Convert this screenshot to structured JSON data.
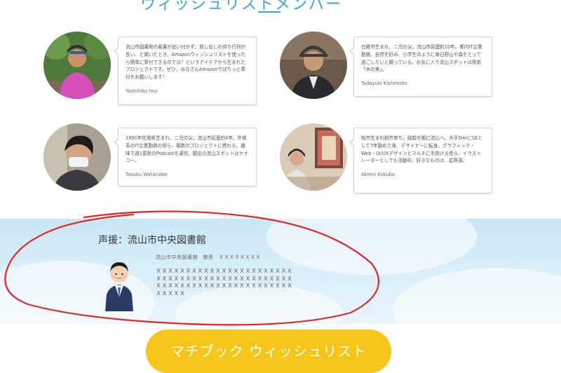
{
  "section": {
    "title": "ウィッシュリストメンバー"
  },
  "members": [
    {
      "desc": "流山市図書館の蔵書が追い付かず、貸し出しの待ち行列が長い、と聞いたとき、Amazonウィッシュリストを使ったら簡単に寄付できるのでは？というアイデアから生まれたプロジェクトです。ぜひ、みなさんAmazonでぽちっと寄付をお願いします！",
      "name": "Yoshihiko Inui"
    },
    {
      "desc": "白雁市生まれ、二児の父。流山市民歴約10年。都内IT企業勤務。自然を好み、小学生のように毎日野山や森をとって過ごしたいと願っている。お気に入り流山スポットは喫茶「木の実」。",
      "name": "Tadayuki Kishimoto"
    },
    {
      "desc": "1990年佐賀県生まれ、二児の父。流山市民歴約4年。外資系のIT企業勤務の傍ら、複数のプロジェクトに携わる。趣味で週1更新のPodcastを運営。願出の流山スポットはヤオコー。",
      "name": "Tasuku Watanabe"
    },
    {
      "desc": "柏市生まれ柏市育ち。結婚を期に流山へ。大手SIerにSEとして7年勤めた後、デザイナーに転身。グラフィック・Web・UI/UXデザインとマルチに手掛ける傍ら、イラストレーターとしても活動中。好きなものは、星野源。",
      "name": "Akemi Kokubo"
    }
  ],
  "support": {
    "title": "声援：流山市中央図書館",
    "role": "流山市中央図書館　館長　ＸＸＸＸＸＸＸＸ",
    "message": "ＸＸＸＸＸＸＸＸＸＸＸＸＸＸＸＸＸＸＸＸＸＸＸＸＸＸＸＸＸＸＸＸＸＸＸＸＸＸＸＸＸＸＸＸＸＸＸＸＸＸＸＸＸＸＸＸＸＸＸＸＸＸＸＸＸＸＸＸＸＸＸＸＸＸ"
  },
  "cta": {
    "label": "マチブック ウィッシュリスト"
  },
  "colors": {
    "accent": "#39a6d8",
    "cta": "#f5c518",
    "annotation": "#e0262b",
    "support_bg": "#d8eef9"
  },
  "icons": {
    "staff": "staff-illustration"
  }
}
